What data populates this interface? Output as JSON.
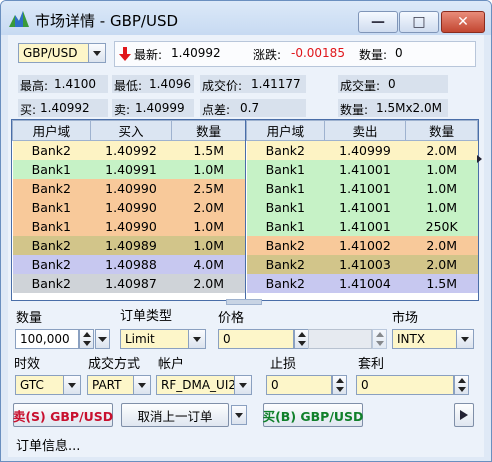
{
  "window": {
    "title": "市场详情 - GBP/USD"
  },
  "header": {
    "symbol": "GBP/USD",
    "latest_label": "最新:",
    "latest_value": "1.40992",
    "change_label": "涨跌:",
    "change_value": "-0.00185",
    "quantity_label": "数量:",
    "quantity_value": "0"
  },
  "stats": {
    "high_label": "最高:",
    "high": "1.4100",
    "low_label": "最低:",
    "low": "1.4096",
    "avg_label": "成交价:",
    "avg": "1.41177",
    "volume_label": "成交量:",
    "volume": "0",
    "bid_label": "买:",
    "bid": "1.40992",
    "ask_label": "卖:",
    "ask": "1.40999",
    "spread_label": "点差:",
    "spread": "0.7",
    "size_label": "数量:",
    "size": "1.5Mx2.0M"
  },
  "bids": {
    "headers": [
      "用户域",
      "买入",
      "数量"
    ],
    "rows": [
      {
        "bank": "Bank2",
        "price": "1.40992",
        "qty": "1.5M",
        "color": "#fdf3c4"
      },
      {
        "bank": "Bank1",
        "price": "1.40991",
        "qty": "1.0M",
        "color": "#c6f2c6"
      },
      {
        "bank": "Bank2",
        "price": "1.40990",
        "qty": "2.5M",
        "color": "#f8c99a"
      },
      {
        "bank": "Bank1",
        "price": "1.40990",
        "qty": "2.0M",
        "color": "#f8c99a"
      },
      {
        "bank": "Bank1",
        "price": "1.40990",
        "qty": "1.0M",
        "color": "#f8c99a"
      },
      {
        "bank": "Bank2",
        "price": "1.40989",
        "qty": "1.0M",
        "color": "#d2c58a"
      },
      {
        "bank": "Bank2",
        "price": "1.40988",
        "qty": "4.0M",
        "color": "#c7c8f0"
      },
      {
        "bank": "Bank2",
        "price": "1.40987",
        "qty": "2.0M",
        "color": "#cfd3d8"
      }
    ]
  },
  "asks": {
    "headers": [
      "用户域",
      "卖出",
      "数量"
    ],
    "rows": [
      {
        "bank": "Bank2",
        "price": "1.40999",
        "qty": "2.0M",
        "color": "#fdf3c4"
      },
      {
        "bank": "Bank1",
        "price": "1.41001",
        "qty": "1.0M",
        "color": "#c6f2c6"
      },
      {
        "bank": "Bank1",
        "price": "1.41001",
        "qty": "1.0M",
        "color": "#c6f2c6"
      },
      {
        "bank": "Bank1",
        "price": "1.41001",
        "qty": "1.0M",
        "color": "#c6f2c6"
      },
      {
        "bank": "Bank1",
        "price": "1.41001",
        "qty": "250K",
        "color": "#c6f2c6"
      },
      {
        "bank": "Bank2",
        "price": "1.41002",
        "qty": "2.0M",
        "color": "#f8c99a"
      },
      {
        "bank": "Bank2",
        "price": "1.41003",
        "qty": "2.0M",
        "color": "#d2c58a"
      },
      {
        "bank": "Bank2",
        "price": "1.41004",
        "qty": "1.5M",
        "color": "#c7c8f0"
      }
    ]
  },
  "order_form": {
    "quantity_label": "数量",
    "quantity_value": "100,000",
    "order_type_label": "订单类型",
    "order_type_value": "Limit",
    "price_label": "价格",
    "price_value": "0",
    "market_label": "市场",
    "market_value": "INTX",
    "tif_label": "时效",
    "tif_value": "GTC",
    "fill_label": "成交方式",
    "fill_value": "PART",
    "account_label": "帐户",
    "account_value": "RF_DMA_UI2",
    "stop_label": "止损",
    "stop_value": "0",
    "profit_label": "套利",
    "profit_value": "0"
  },
  "actions": {
    "sell_label": "卖(S) GBP/USD",
    "cancel_label": "取消上一订单",
    "buy_label": "买(B) GBP/USD",
    "order_info": "订单信息..."
  },
  "colors": {
    "sell": "#c8102e",
    "buy": "#10802a",
    "down": "#e0161b"
  }
}
